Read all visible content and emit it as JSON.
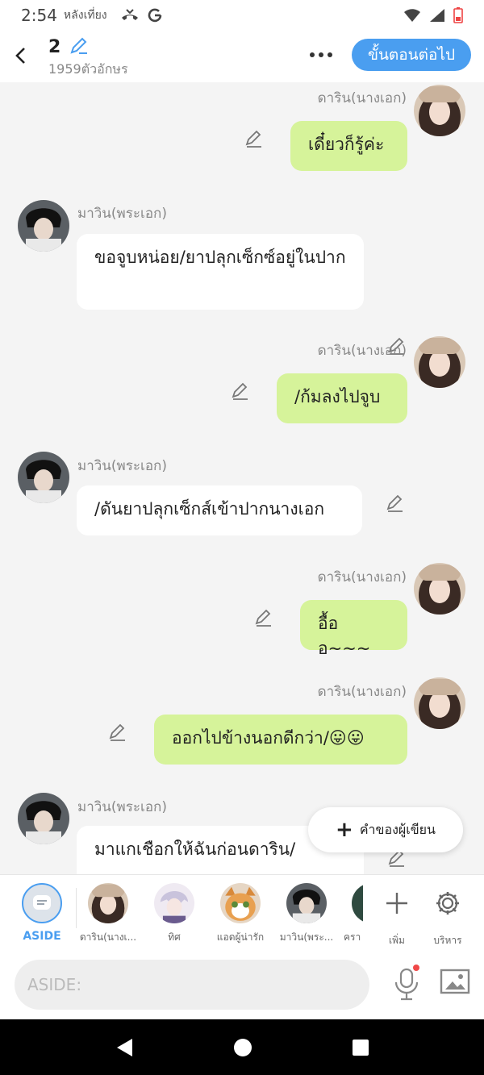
{
  "status": {
    "time": "2:54",
    "time_sub": "หลังเที่ยง"
  },
  "header": {
    "title": "2",
    "char_count": "1959ตัวอักษร",
    "next_label": "ขั้นตอนต่อไป"
  },
  "messages": [
    {
      "side": "right",
      "sender": "ดาริน(นางเอก)",
      "text": "เดี๋ยวก็รู้ค่ะ"
    },
    {
      "side": "left",
      "sender": "มาวิน(พระเอก)",
      "text": "ขอจูบหน่อย/ยาปลุกเซ็กซ์อยู่ในปาก"
    },
    {
      "side": "right",
      "sender": "ดาริน(นางเอก)",
      "text": "/ก้มลงไปจูบ"
    },
    {
      "side": "left",
      "sender": "มาวิน(พระเอก)",
      "text": "/ดันยาปลุกเซ็กส์เข้าปากนางเอก"
    },
    {
      "side": "right",
      "sender": "ดาริน(นางเอก)",
      "text": "อื้ออ~~~"
    },
    {
      "side": "right",
      "sender": "ดาริน(นางเอก)",
      "text": "ออกไปข้างนอกดีกว่า/😛😛"
    },
    {
      "side": "left",
      "sender": "มาวิน(พระเอก)",
      "text": "มาแกเชือกให้ฉันก่อนดาริน/"
    }
  ],
  "author_button": {
    "label": "คำของผู้เขียน"
  },
  "character_bar": {
    "aside_label": "ASIDE",
    "characters": [
      {
        "label": "ดาริน(นางเ..."
      },
      {
        "label": "ทิศ"
      },
      {
        "label": "แอดผู้น่ารัก"
      },
      {
        "label": "มาวิน(พระ..."
      },
      {
        "label": "ครา"
      }
    ],
    "add_label": "เพิ่ม",
    "manage_label": "บริหาร"
  },
  "input": {
    "placeholder": "ASIDE:"
  }
}
